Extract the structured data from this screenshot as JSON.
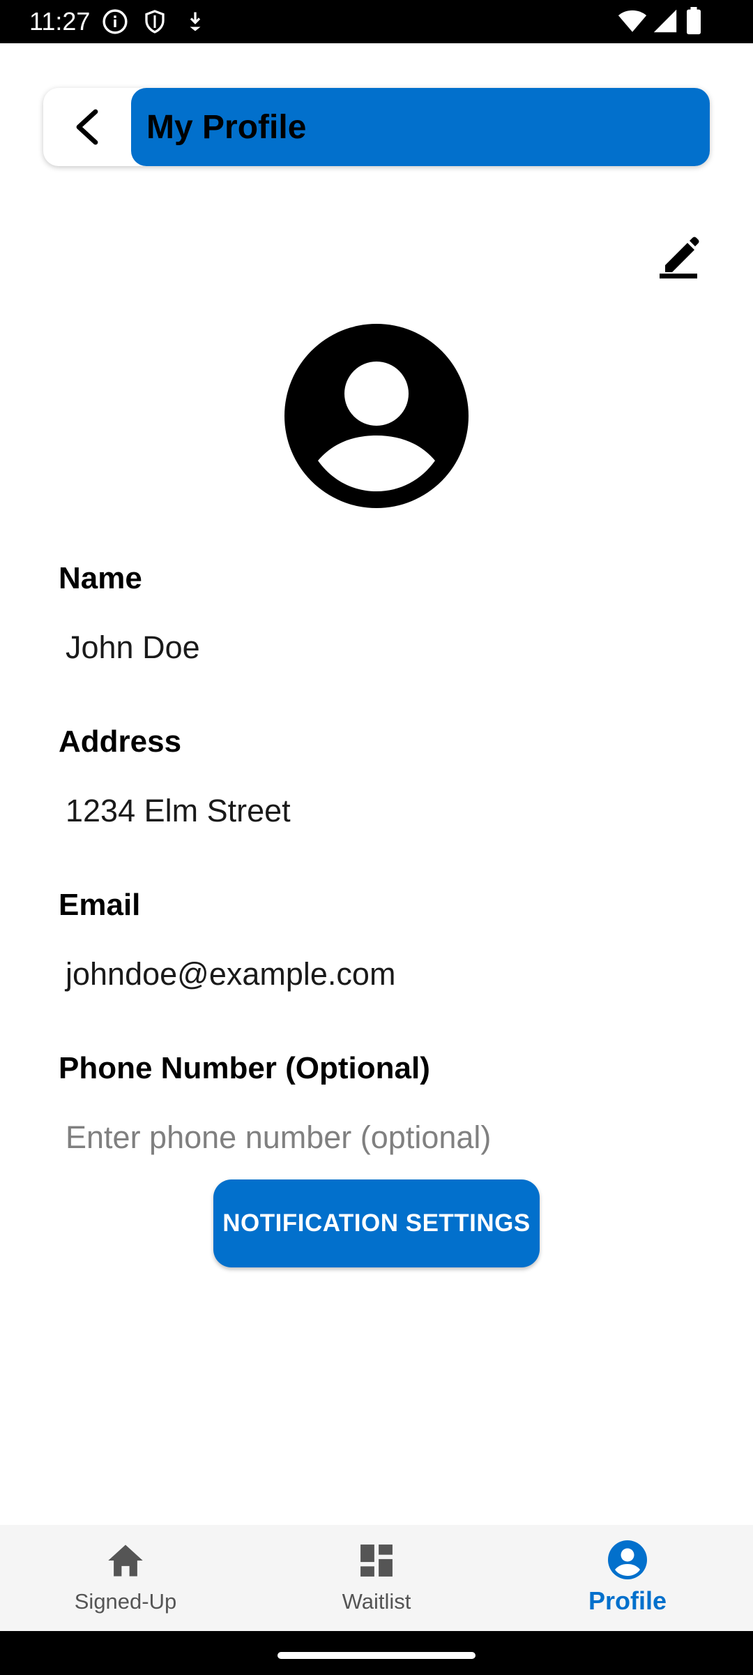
{
  "status_bar": {
    "time": "11:27",
    "icons_left": [
      "info-icon",
      "shield-icon",
      "download-icon"
    ],
    "icons_right": [
      "wifi-icon",
      "signal-icon",
      "battery-icon"
    ]
  },
  "header": {
    "back_icon": "chevron-left-icon",
    "title": "My Profile"
  },
  "edit_icon": "pencil-icon",
  "avatar_icon": "account-circle-icon",
  "fields": {
    "name": {
      "label": "Name",
      "value": "John Doe"
    },
    "address": {
      "label": "Address",
      "value": "1234 Elm Street"
    },
    "email": {
      "label": "Email",
      "value": "johndoe@example.com"
    },
    "phone": {
      "label": "Phone Number (Optional)",
      "value": "",
      "placeholder": "Enter phone number (optional)"
    }
  },
  "notification_button": {
    "label": "NOTIFICATION SETTINGS"
  },
  "bottom_nav": {
    "items": [
      {
        "label": "Signed-Up",
        "icon": "home-icon",
        "active": false
      },
      {
        "label": "Waitlist",
        "icon": "dashboard-icon",
        "active": false
      },
      {
        "label": "Profile",
        "icon": "account-circle-icon",
        "active": true
      }
    ]
  },
  "colors": {
    "accent": "#0270CC",
    "nav_background": "#F5F5F5",
    "nav_inactive": "#555555",
    "placeholder": "#808080"
  }
}
